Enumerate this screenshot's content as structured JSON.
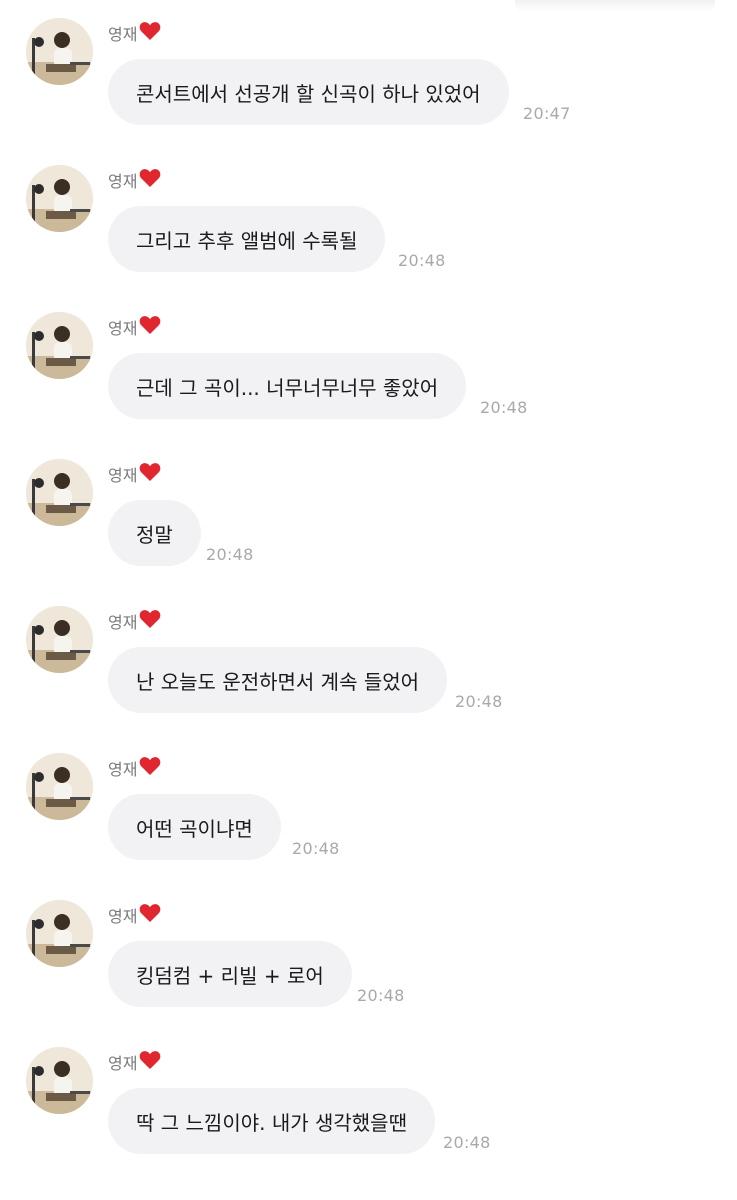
{
  "colors": {
    "bubble": "#f2f2f5",
    "message_text": "#1a1a1a",
    "sender_text": "#7a7a7e",
    "time_text": "#a9a9ad",
    "heart": "#e0262e"
  },
  "messages": [
    {
      "sender": "영재",
      "sender_icon": "heart-icon",
      "text": "콘서트에서 선공개 할 신곡이 하나 있었어",
      "time": "20:47"
    },
    {
      "sender": "영재",
      "sender_icon": "heart-icon",
      "text": "그리고 추후 앨범에 수록될",
      "time": "20:48"
    },
    {
      "sender": "영재",
      "sender_icon": "heart-icon",
      "text": "근데 그 곡이... 너무너무너무 좋았어",
      "time": "20:48"
    },
    {
      "sender": "영재",
      "sender_icon": "heart-icon",
      "text": "정말",
      "time": "20:48"
    },
    {
      "sender": "영재",
      "sender_icon": "heart-icon",
      "text": "난 오늘도 운전하면서 계속 들었어",
      "time": "20:48"
    },
    {
      "sender": "영재",
      "sender_icon": "heart-icon",
      "text": "어떤 곡이냐면",
      "time": "20:48"
    },
    {
      "sender": "영재",
      "sender_icon": "heart-icon",
      "text": "킹덤컴 + 리빌 + 로어",
      "time": "20:48"
    },
    {
      "sender": "영재",
      "sender_icon": "heart-icon",
      "text": "딱 그 느낌이야. 내가 생각했을땐",
      "time": "20:48"
    }
  ]
}
